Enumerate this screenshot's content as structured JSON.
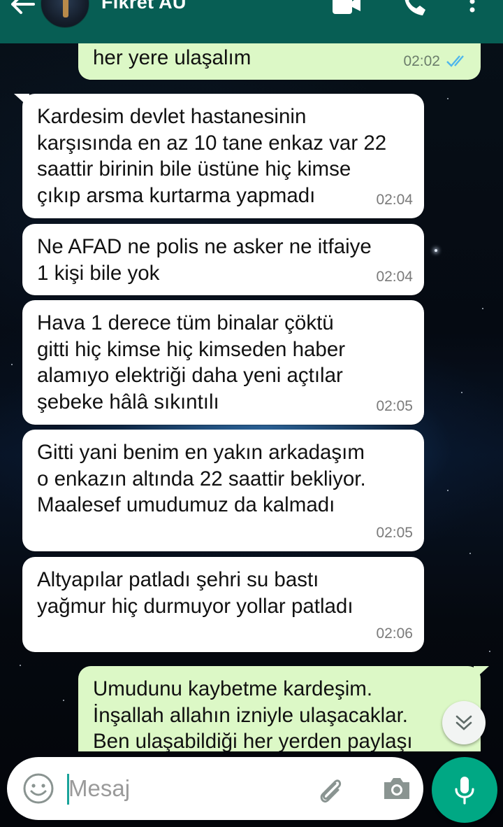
{
  "header": {
    "contact_name": "Fikret AU",
    "background_color": "#075e54",
    "icons": [
      "back-arrow-icon",
      "video-call-icon",
      "phone-icon",
      "more-options-icon"
    ]
  },
  "messages": [
    {
      "direction": "out",
      "text": "her yere ulaşalım",
      "time": "02:02",
      "status": "read"
    },
    {
      "direction": "in",
      "text": "Kardesim devlet hastanesinin\nkarşısında en az 10 tane enkaz var 22\nsaattir birinin bile üstüne hiç kimse\nçıkıp arsma kurtarma yapmadı",
      "time": "02:04"
    },
    {
      "direction": "in",
      "text": "Ne AFAD ne polis ne asker ne itfaiye\n1 kişi bile yok",
      "time": "02:04"
    },
    {
      "direction": "in",
      "text": "Hava 1 derece tüm binalar çöktü\ngitti hiç kimse hiç kimseden haber\nalamıyo elektriği daha yeni açtılar\nşebeke hâlâ sıkıntılı",
      "time": "02:05"
    },
    {
      "direction": "in",
      "text": "Gitti yani benim en yakın arkadaşım\no enkazın altında 22 saattir bekliyor.\nMaalesef umudumuz da kalmadı",
      "time": "02:05"
    },
    {
      "direction": "in",
      "text": "Altyapılar patladı şehri su bastı\nyağmur hiç durmuyor yollar patladı",
      "time": "02:06"
    },
    {
      "direction": "out",
      "text": "Umudunu kaybetme kardeşim.\nİnşallah allahın izniyle ulaşacaklar.\nBen ulaşabildiği her yerden paylaşı",
      "time": "",
      "status": ""
    }
  ],
  "input": {
    "placeholder": "Mesaj",
    "value": ""
  },
  "colors": {
    "incoming_bubble": "#ffffff",
    "outgoing_bubble": "#dcf8c6",
    "read_ticks": "#4fb6ec",
    "mic_button": "#00a884"
  }
}
